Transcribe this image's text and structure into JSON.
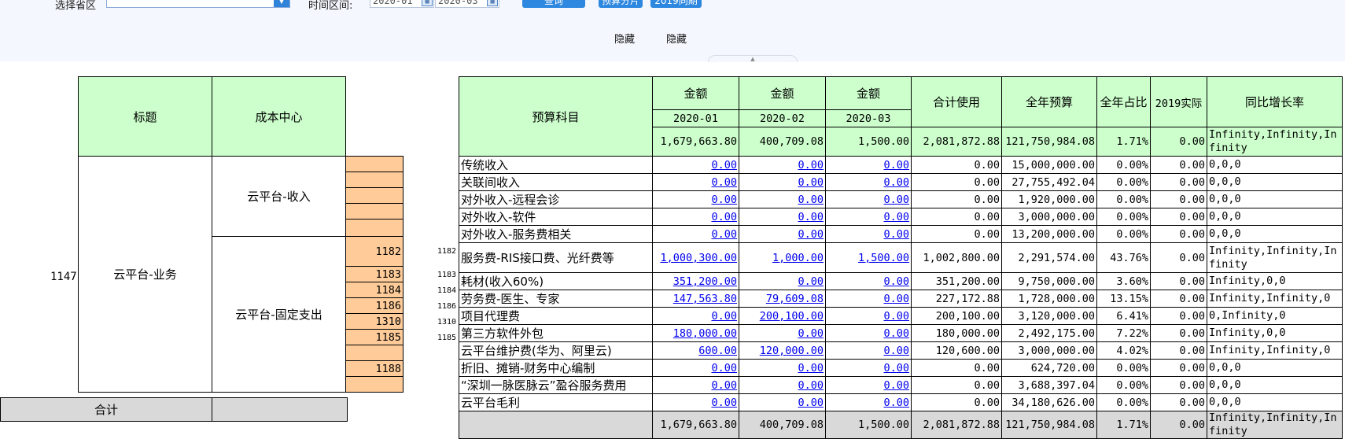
{
  "filters": {
    "region_label": "选择省区",
    "region_value": "",
    "period_label": "时间区间:",
    "date_from": "2020-01",
    "date_to": "2020-03",
    "query_button": "查询",
    "split_button": "预算分片",
    "compare_button": "2019同期",
    "calendar_icon": "calendar-icon",
    "dropdown_icon": "chevron-down-icon"
  },
  "hide_links": [
    "隐藏",
    "隐藏"
  ],
  "left_table": {
    "header_title": "标题",
    "header_cost_center": "成本中心",
    "row_id": "1147",
    "group_name": "云平台-业务",
    "sub_income": "云平台-收入",
    "sub_fixed": "云平台-固定支出",
    "codes": [
      "1182",
      "1183",
      "1184",
      "1186",
      "1310",
      "1185",
      "",
      "1188",
      ""
    ],
    "total_label": "合计"
  },
  "main_table": {
    "header_subject": "预算科目",
    "header_amount": "金额",
    "months": [
      "2020-01",
      "2020-02",
      "2020-03"
    ],
    "header_total_used": "合计使用",
    "header_annual_budget": "全年预算",
    "header_annual_ratio": "全年占比",
    "header_2019": "2019实际",
    "header_yoy": "同比增长率",
    "summary": {
      "m1": "1,679,663.80",
      "m2": "400,709.08",
      "m3": "1,500.00",
      "total": "2,081,872.88",
      "budget": "121,750,984.08",
      "ratio": "1.71%",
      "actual2019": "0.00",
      "yoy": "Infinity,Infinity,Infinity"
    },
    "rows": [
      {
        "code": "",
        "name": "传统收入",
        "m1": "0.00",
        "m2": "0.00",
        "m3": "0.00",
        "total": "0.00",
        "budget": "15,000,000.00",
        "ratio": "0.00%",
        "actual2019": "0.00",
        "yoy": "0,0,0"
      },
      {
        "code": "",
        "name": "关联间收入",
        "m1": "0.00",
        "m2": "0.00",
        "m3": "0.00",
        "total": "0.00",
        "budget": "27,755,492.04",
        "ratio": "0.00%",
        "actual2019": "0.00",
        "yoy": "0,0,0"
      },
      {
        "code": "",
        "name": "对外收入-远程会诊",
        "m1": "0.00",
        "m2": "0.00",
        "m3": "0.00",
        "total": "0.00",
        "budget": "1,920,000.00",
        "ratio": "0.00%",
        "actual2019": "0.00",
        "yoy": "0,0,0"
      },
      {
        "code": "",
        "name": "对外收入-软件",
        "m1": "0.00",
        "m2": "0.00",
        "m3": "0.00",
        "total": "0.00",
        "budget": "3,000,000.00",
        "ratio": "0.00%",
        "actual2019": "0.00",
        "yoy": "0,0,0"
      },
      {
        "code": "",
        "name": "对外收入-服务费相关",
        "m1": "0.00",
        "m2": "0.00",
        "m3": "0.00",
        "total": "0.00",
        "budget": "13,200,000.00",
        "ratio": "0.00%",
        "actual2019": "0.00",
        "yoy": "0,0,0"
      },
      {
        "code": "1182",
        "name": "服务费-RIS接口费、光纤费等",
        "m1": "1,000,300.00",
        "m2": "1,000.00",
        "m3": "1,500.00",
        "total": "1,002,800.00",
        "budget": "2,291,574.00",
        "ratio": "43.76%",
        "actual2019": "0.00",
        "yoy": "Infinity,Infinity,Infinity",
        "tall": true
      },
      {
        "code": "1183",
        "name": "耗材(收入60%)",
        "m1": "351,200.00",
        "m2": "0.00",
        "m3": "0.00",
        "total": "351,200.00",
        "budget": "9,750,000.00",
        "ratio": "3.60%",
        "actual2019": "0.00",
        "yoy": "Infinity,0,0"
      },
      {
        "code": "1184",
        "name": "劳务费-医生、专家",
        "m1": "147,563.80",
        "m2": "79,609.08",
        "m3": "0.00",
        "total": "227,172.88",
        "budget": "1,728,000.00",
        "ratio": "13.15%",
        "actual2019": "0.00",
        "yoy": "Infinity,Infinity,0"
      },
      {
        "code": "1186",
        "name": "项目代理费",
        "m1": "0.00",
        "m2": "200,100.00",
        "m3": "0.00",
        "total": "200,100.00",
        "budget": "3,120,000.00",
        "ratio": "6.41%",
        "actual2019": "0.00",
        "yoy": "0,Infinity,0"
      },
      {
        "code": "1310",
        "name": "第三方软件外包",
        "m1": "180,000.00",
        "m2": "0.00",
        "m3": "0.00",
        "total": "180,000.00",
        "budget": "2,492,175.00",
        "ratio": "7.22%",
        "actual2019": "0.00",
        "yoy": "Infinity,0,0"
      },
      {
        "code": "1185",
        "name": "云平台维护费(华为、阿里云)",
        "m1": "600.00",
        "m2": "120,000.00",
        "m3": "0.00",
        "total": "120,600.00",
        "budget": "3,000,000.00",
        "ratio": "4.02%",
        "actual2019": "0.00",
        "yoy": "Infinity,Infinity,0"
      },
      {
        "code": "",
        "name": "折旧、摊销-财务中心编制",
        "m1": "0.00",
        "m2": "0.00",
        "m3": "0.00",
        "total": "0.00",
        "budget": "624,720.00",
        "ratio": "0.00%",
        "actual2019": "0.00",
        "yoy": "0,0,0"
      },
      {
        "code": "",
        "name": "“深圳一脉医脉云”盈谷服务费用",
        "m1": "0.00",
        "m2": "0.00",
        "m3": "0.00",
        "total": "0.00",
        "budget": "3,688,397.04",
        "ratio": "0.00%",
        "actual2019": "0.00",
        "yoy": "0,0,0"
      },
      {
        "code": "",
        "name": "云平台毛利",
        "m1": "0.00",
        "m2": "0.00",
        "m3": "0.00",
        "total": "0.00",
        "budget": "34,180,626.00",
        "ratio": "0.00%",
        "actual2019": "0.00",
        "yoy": "0,0,0"
      }
    ],
    "totals": {
      "m1": "1,679,663.80",
      "m2": "400,709.08",
      "m3": "1,500.00",
      "total": "2,081,872.88",
      "budget": "121,750,984.08",
      "ratio": "1.71%",
      "actual2019": "0.00",
      "yoy": "Infinity,Infinity,Infinity"
    }
  }
}
